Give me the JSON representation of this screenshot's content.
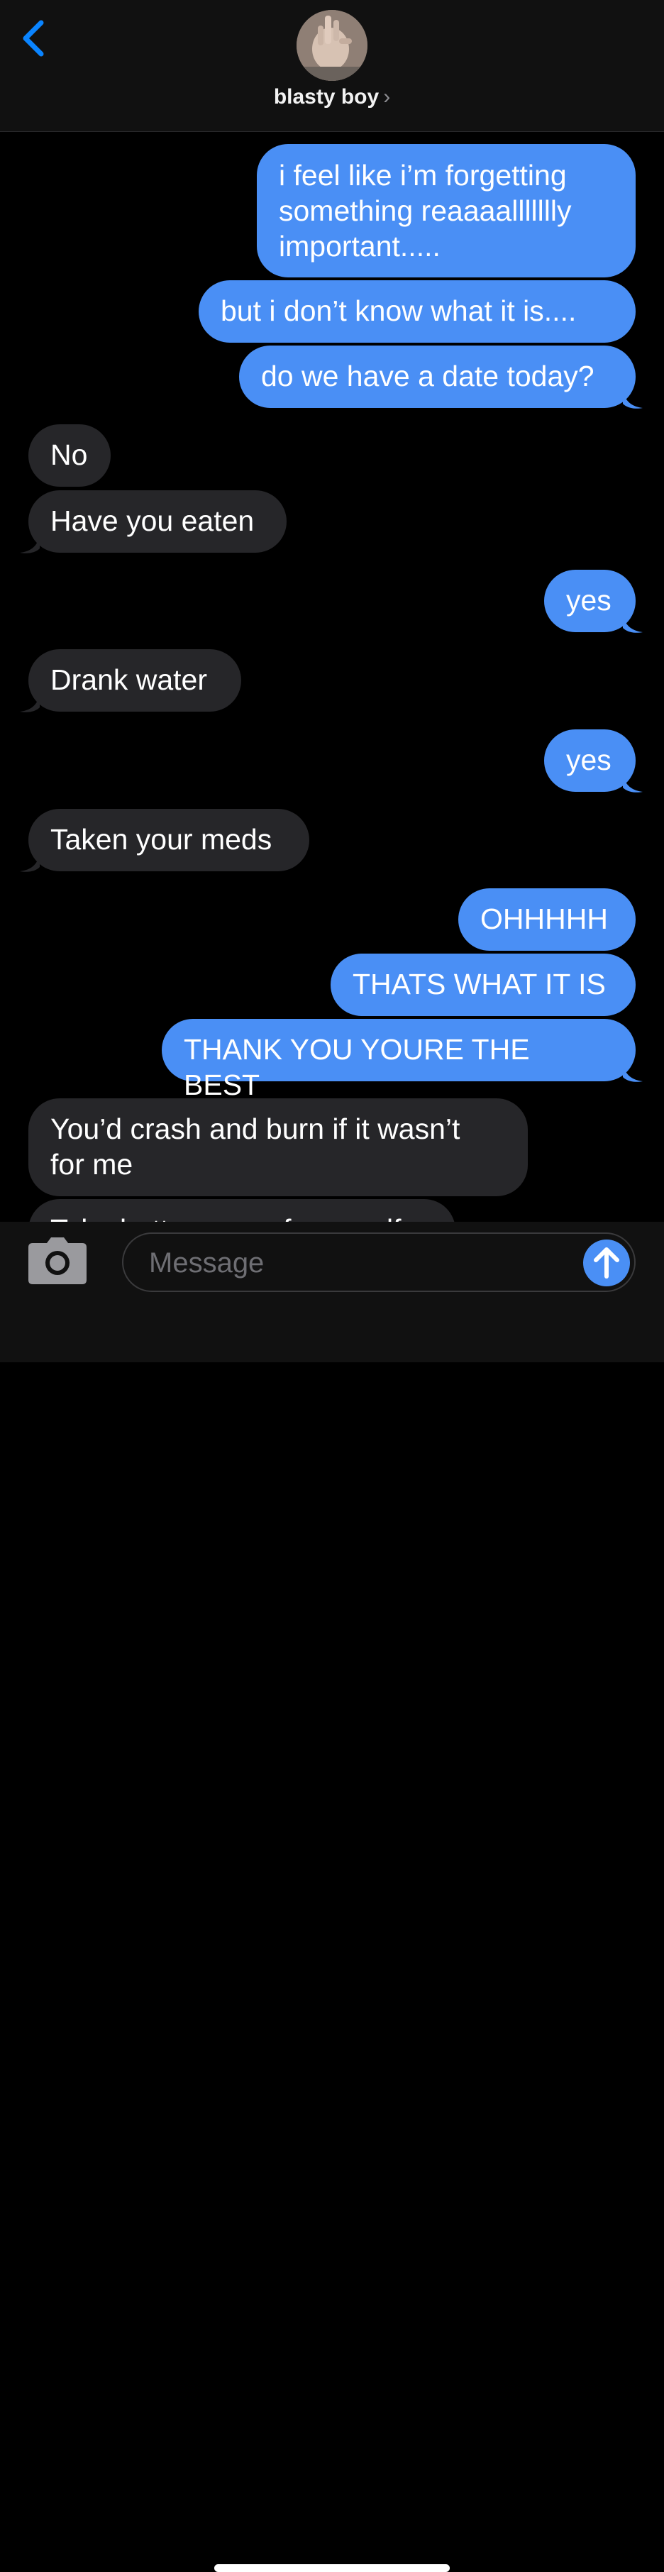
{
  "header": {
    "contact_name": "blasty boy",
    "chevron": "›",
    "back_icon": "chevron-left-icon",
    "accent_color": "#0a84ff"
  },
  "messages": [
    {
      "from": "me",
      "text": "i feel like i’m forgetting\nsomething reaaaallllllly\nimportant....."
    },
    {
      "from": "me",
      "text": "but i don’t know what it is...."
    },
    {
      "from": "me",
      "text": "do we have a date today?"
    },
    {
      "from": "them",
      "text": "No"
    },
    {
      "from": "them",
      "text": "Have you eaten"
    },
    {
      "from": "me",
      "text": "yes"
    },
    {
      "from": "them",
      "text": "Drank water"
    },
    {
      "from": "me",
      "text": "yes"
    },
    {
      "from": "them",
      "text": "Taken your meds"
    },
    {
      "from": "me",
      "text": "OHHHHH"
    },
    {
      "from": "me",
      "text": "THATS WHAT IT IS"
    },
    {
      "from": "me",
      "text": "THANK YOU YOURE THE BEST"
    },
    {
      "from": "them",
      "text": "You’d crash and burn if it wasn’t\nfor me"
    },
    {
      "from": "them",
      "text": "Take better care of yourself"
    }
  ],
  "input": {
    "placeholder": "Message",
    "camera_icon": "camera-icon",
    "send_icon": "arrow-up-icon"
  },
  "colors": {
    "sent_bubble": "#4a8ff5",
    "received_bubble": "#262629",
    "background": "#000000"
  }
}
